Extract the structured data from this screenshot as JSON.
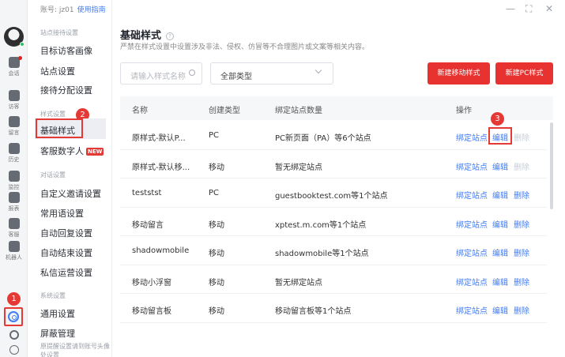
{
  "account": {
    "label": "账号: jz01",
    "guide": "使用指南"
  },
  "rail": {
    "items": [
      {
        "label": "会话",
        "icon": "chat-icon"
      },
      {
        "label": "访客",
        "icon": "visitors-icon"
      },
      {
        "label": "留言",
        "icon": "message-icon"
      },
      {
        "label": "历史",
        "icon": "history-icon"
      },
      {
        "label": "监控",
        "icon": "monitor-icon"
      },
      {
        "label": "报表",
        "icon": "report-icon"
      },
      {
        "label": "客服",
        "icon": "agent-icon"
      },
      {
        "label": "机器人",
        "icon": "robot-icon"
      }
    ]
  },
  "sidebar": {
    "groups": {
      "site": "站点接待设置",
      "style": "样式设置",
      "dialog": "对话设置",
      "system": "系统设置"
    },
    "items": {
      "target_portrait": "目标访客画像",
      "site_settings": "站点设置",
      "reception": "接待分配设置",
      "basic_style": "基础样式",
      "digital_human": "客服数字人",
      "invite": "自定义邀请设置",
      "phrases": "常用语设置",
      "auto_reply": "自动回复设置",
      "auto_end": "自动结束设置",
      "private": "私信运营设置",
      "general": "通用设置",
      "block": "屏蔽管理",
      "reminder": "原提醒设置请到账号头像处设置"
    },
    "new_tag": "NEW"
  },
  "badges": {
    "one": "1",
    "two": "2",
    "three": "3"
  },
  "page": {
    "title": "基础样式",
    "help": "?",
    "subtitle": "严禁在样式设置中设置涉及非法、侵权、仿冒等不合理图片或文案等相关内容。"
  },
  "filters": {
    "search_placeholder": "请输入样式名称",
    "type_value": "全部类型"
  },
  "buttons": {
    "new_mobile": "新建移动样式",
    "new_pc": "新建PC样式"
  },
  "table": {
    "headers": [
      "名称",
      "创建类型",
      "绑定站点数量",
      "操作"
    ],
    "rows": [
      {
        "name": "原样式-默认P...",
        "type": "PC",
        "sites": "PC新页面（PA）等6个站点",
        "delete_disabled": true
      },
      {
        "name": "原样式-默认移...",
        "type": "移动",
        "sites": "暂无绑定站点",
        "delete_disabled": true
      },
      {
        "name": "teststst",
        "type": "PC",
        "sites": "guestbooktest.com等1个站点",
        "delete_disabled": false
      },
      {
        "name": "移动留言",
        "type": "移动",
        "sites": "xptest.m.com等1个站点",
        "delete_disabled": false
      },
      {
        "name": "shadowmobile",
        "type": "移动",
        "sites": "shadowmobile等1个站点",
        "delete_disabled": false
      },
      {
        "name": "移动小浮窗",
        "type": "移动",
        "sites": "暂无绑定站点",
        "delete_disabled": false
      },
      {
        "name": "移动留言板",
        "type": "移动",
        "sites": "移动留言板等1个站点",
        "delete_disabled": false
      }
    ],
    "actions": {
      "bind": "绑定站点",
      "edit": "编辑",
      "delete": "删除"
    }
  },
  "window": {
    "minimize": "—",
    "maximize": "⛶",
    "close": "✕"
  },
  "colors": {
    "primary": "#3f7cf5",
    "danger": "#e8322f",
    "highlight": "#e53935"
  }
}
